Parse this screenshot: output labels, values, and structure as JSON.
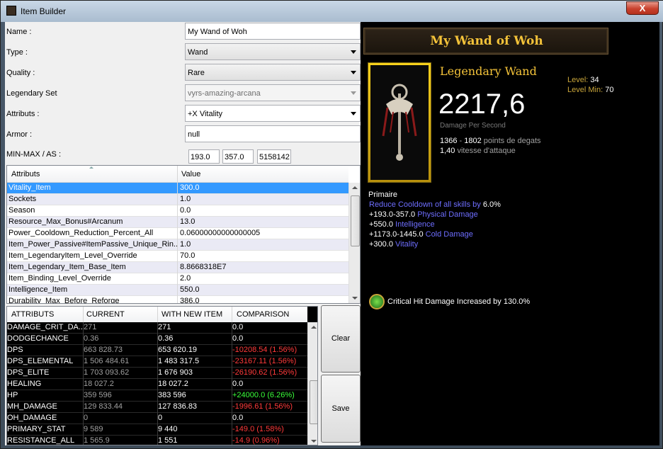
{
  "window": {
    "title": "Item Builder",
    "close": "X"
  },
  "form": {
    "name": {
      "label": "Name :",
      "value": "My Wand of Woh"
    },
    "type": {
      "label": "Type :",
      "value": "Wand"
    },
    "quality": {
      "label": "Quality :",
      "value": "Rare"
    },
    "legendary_set": {
      "label": "Legendary Set",
      "value": "vyrs-amazing-arcana"
    },
    "attributs": {
      "label": "Attributs :",
      "value": "+X Vitality"
    },
    "armor": {
      "label": "Armor :",
      "value": "null"
    },
    "minmax": {
      "label": "MIN-MAX / AS :",
      "min": "193.0",
      "max": "357.0",
      "as": "5158142"
    }
  },
  "attr_table": {
    "headers": [
      "Attributs",
      "Value"
    ],
    "rows": [
      [
        "Vitality_Item",
        "300.0"
      ],
      [
        "Sockets",
        "1.0"
      ],
      [
        "Season",
        "0.0"
      ],
      [
        "Resource_Max_Bonus#Arcanum",
        "13.0"
      ],
      [
        "Power_Cooldown_Reduction_Percent_All",
        "0.06000000000000005"
      ],
      [
        "Item_Power_Passive#ItemPassive_Unique_Rin...",
        "1.0"
      ],
      [
        "Item_LegendaryItem_Level_Override",
        "70.0"
      ],
      [
        "Item_Legendary_Item_Base_Item",
        "8.8668318E7"
      ],
      [
        "Item_Binding_Level_Override",
        "2.0"
      ],
      [
        "Intelligence_Item",
        "550.0"
      ],
      [
        "Durability_Max_Before_Reforge",
        "386.0"
      ]
    ]
  },
  "cmp_table": {
    "headers": [
      "ATTRIBUTS",
      "CURRENT",
      "WITH NEW ITEM",
      "COMPARISON"
    ],
    "rows": [
      {
        "k": "DAMAGE_CRIT_DA...",
        "cur": "271",
        "new": "271",
        "cmp": "0.0",
        "s": ""
      },
      {
        "k": "DODGECHANCE",
        "cur": "0.36",
        "new": "0.36",
        "cmp": "0.0",
        "s": ""
      },
      {
        "k": "DPS",
        "cur": "663 828.73",
        "new": "653 620.19",
        "cmp": "-10208.54 (1.56%)",
        "s": "neg"
      },
      {
        "k": "DPS_ELEMENTAL",
        "cur": "1 506 484.61",
        "new": "1 483 317.5",
        "cmp": "-23167.11 (1.56%)",
        "s": "neg"
      },
      {
        "k": "DPS_ELITE",
        "cur": "1 703 093.62",
        "new": "1 676 903",
        "cmp": "-26190.62 (1.56%)",
        "s": "neg"
      },
      {
        "k": "HEALING",
        "cur": "18 027.2",
        "new": "18 027.2",
        "cmp": "0.0",
        "s": ""
      },
      {
        "k": "HP",
        "cur": "359 596",
        "new": "383 596",
        "cmp": "+24000.0 (6.26%)",
        "s": "pos"
      },
      {
        "k": "MH_DAMAGE",
        "cur": "129 833.44",
        "new": "127 836.83",
        "cmp": "-1996.61 (1.56%)",
        "s": "neg"
      },
      {
        "k": "OH_DAMAGE",
        "cur": "0",
        "new": "0",
        "cmp": "0.0",
        "s": ""
      },
      {
        "k": "PRIMARY_STAT",
        "cur": "9 589",
        "new": "9 440",
        "cmp": "-149.0 (1.58%)",
        "s": "neg"
      },
      {
        "k": "RESISTANCE_ALL",
        "cur": "1 565.9",
        "new": "1 551",
        "cmp": "-14.9 (0.96%)",
        "s": "neg"
      }
    ]
  },
  "buttons": {
    "clear": "Clear",
    "save": "Save"
  },
  "tooltip": {
    "name": "My Wand of Woh",
    "type": "Legendary Wand",
    "dps": "2217,6",
    "dps_label": "Damage Per Second",
    "dmg_min": "1366",
    "dmg_sep": " - ",
    "dmg_max": "1802",
    "dmg_suffix": " points de degats",
    "aspd": "1,40",
    "aspd_suffix": " vitesse d'attaque",
    "level_label": "Level:",
    "level": "34",
    "level_min_label": "Level Min:",
    "level_min": "70",
    "primary": "Primaire",
    "affixes": [
      {
        "a": "Reduce Cooldown of all skills by ",
        "b": "6.0%",
        "a_blue": true,
        "b_blue": false
      },
      {
        "a": "+193.0-357.0 ",
        "b": "Physical Damage",
        "a_blue": false,
        "b_blue": true
      },
      {
        "a": "+550.0 ",
        "b": "Intelligence",
        "a_blue": false,
        "b_blue": true
      },
      {
        "a": "+1173.0-1445.0 ",
        "b": "Cold Damage",
        "a_blue": false,
        "b_blue": true
      },
      {
        "a": "+300.0 ",
        "b": "Vitality",
        "a_blue": false,
        "b_blue": true
      }
    ],
    "legendary_affix": "Critical Hit Damage Increased by 130.0%"
  },
  "colors": {
    "gold": "#f3c239",
    "blue": "#6e6eff",
    "neg": "#ff3a3a",
    "pos": "#3aff3a",
    "selection": "#3399ff"
  }
}
